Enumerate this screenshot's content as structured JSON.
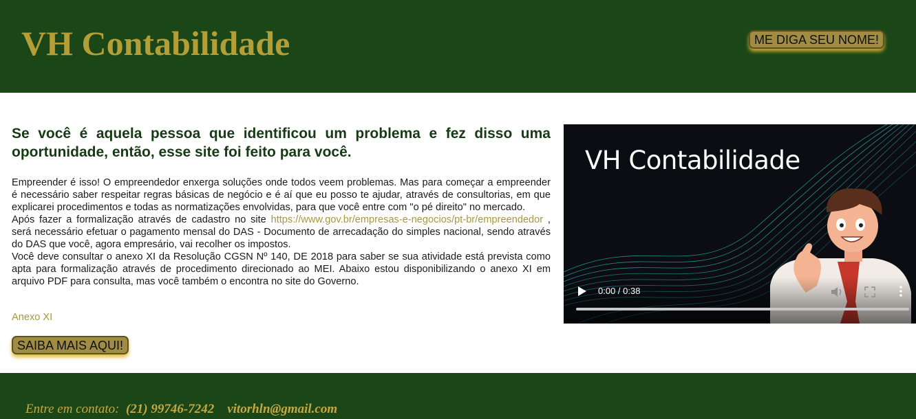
{
  "header": {
    "brand": "VH Contabilidade",
    "name_button": "ME DIGA SEU NOME!"
  },
  "main": {
    "headline": "Se você é aquela pessoa que identificou um problema e fez disso uma oportunidade, então, esse site foi feito para você.",
    "paragraph1": "Empreender é isso! O empreendedor enxerga soluções onde todos veem problemas. Mas para começar a empreender é necessário saber respeitar regras básicas de negócio e é aí que eu posso te ajudar, através de consultorias, em que explicarei procedimentos e todas as normatizações envolvidas, para que você entre com \"o pé direito\" no mercado.",
    "paragraph2_before": "Após fazer a formalização através de cadastro no site ",
    "gov_link": "https://www.gov.br/empresas-e-negocios/pt-br/empreendedor",
    "paragraph2_after": " , será necessário efetuar o pagamento mensal do DAS - Documento de arrecadação do simples nacional, sendo através do DAS que você, agora empresário, vai recolher os impostos.",
    "paragraph3": "Você deve consultar o anexo XI da Resolução CGSN Nº 140, DE 2018 para saber se sua atividade está prevista como apta para formalização através de procedimento direcionado ao MEI. Abaixo estou disponibilizando o anexo XI em arquivo PDF para consulta, mas você também o encontra no site do Governo.",
    "annex_link": "Anexo XI",
    "more_button": "SAIBA MAIS AQUI!"
  },
  "video": {
    "title": "VH Contabilidade",
    "time": "0:00 / 0:38",
    "progress": 0,
    "icons": [
      "play-icon",
      "volume-icon",
      "fullscreen-icon",
      "more-options-icon"
    ]
  },
  "footer": {
    "contact_label": "Entre em contato:",
    "phone": "(21) 99746-7242",
    "email": "vitorhln@gmail.com"
  },
  "colors": {
    "header_bg": "#1a4618",
    "brand_gold": "#b49e37",
    "button_bg": "#a08c44",
    "link": "#a8973f",
    "headline": "#163b14"
  }
}
